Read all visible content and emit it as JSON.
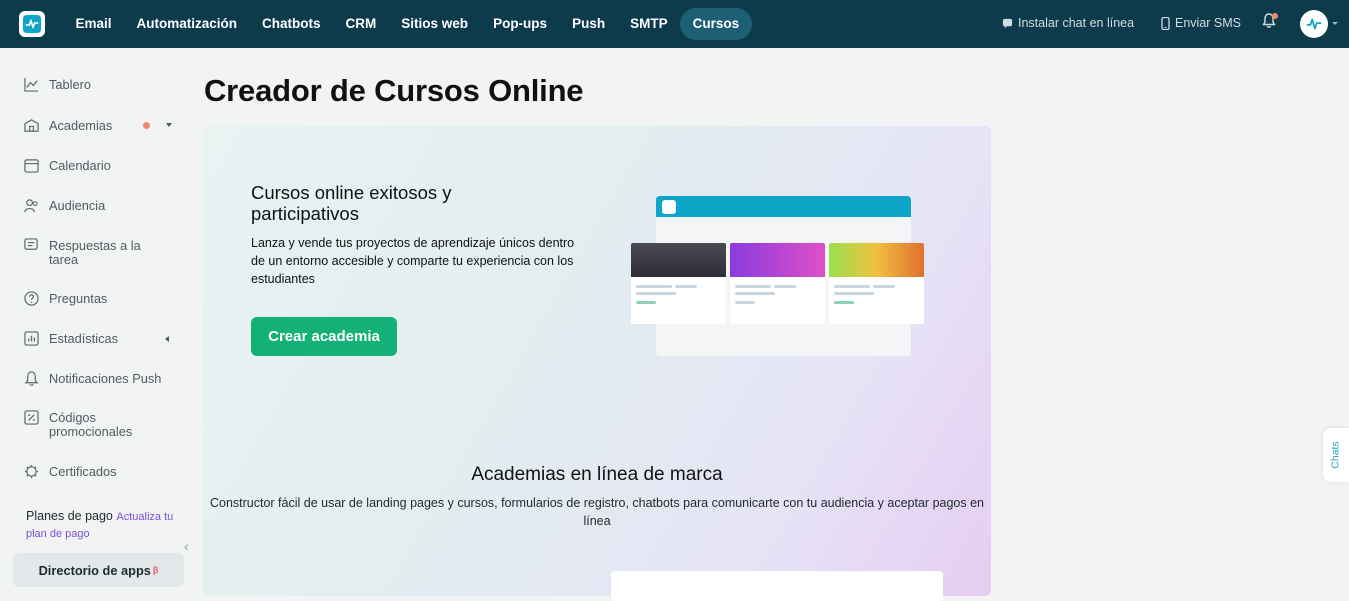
{
  "topnav": {
    "logo_icon": "pulse-logo",
    "items": [
      {
        "label": "Email"
      },
      {
        "label": "Automatización"
      },
      {
        "label": "Chatbots"
      },
      {
        "label": "CRM"
      },
      {
        "label": "Sitios web"
      },
      {
        "label": "Pop-ups"
      },
      {
        "label": "Push"
      },
      {
        "label": "SMTP"
      },
      {
        "label": "Cursos",
        "active": true
      }
    ],
    "install_chat": "Instalar chat en línea",
    "send_sms": "Enviar SMS",
    "notification_dot_color": "#f08a6a"
  },
  "sidebar": {
    "items": [
      {
        "label": "Tablero",
        "icon": "chart-line-icon"
      },
      {
        "label": "Academias",
        "icon": "academy-icon"
      },
      {
        "label": "Calendario",
        "icon": "calendar-icon"
      },
      {
        "label": "Audiencia",
        "icon": "users-icon"
      },
      {
        "label": "Respuestas a la tarea",
        "icon": "answers-icon"
      },
      {
        "label": "Preguntas",
        "icon": "question-icon"
      },
      {
        "label": "Estadísticas",
        "icon": "stats-icon"
      },
      {
        "label": "Notificaciones Push",
        "icon": "bell-icon"
      },
      {
        "label": "Códigos promocionales",
        "icon": "promo-icon"
      },
      {
        "label": "Certificados",
        "icon": "certificate-icon"
      }
    ],
    "plans_label": "Planes de pago",
    "plans_link": "Actualiza tu plan de pago",
    "app_directory": "Directorio de apps",
    "app_directory_badge": "β"
  },
  "main": {
    "title": "Creador de Cursos Online",
    "hero_heading": "Cursos online exitosos y participativos",
    "hero_text": "Lanza y vende tus proyectos de aprendizaje únicos dentro de un entorno accesible y comparte tu experiencia con los estudiantes",
    "cta_label": "Crear academia",
    "section_title": "Academias en línea de marca",
    "section_text": "Constructor fácil de usar de landing pages y cursos, formularios de registro, chatbots para comunicarte con tu audiencia y aceptar pagos en línea"
  },
  "chats_tab": "Chats",
  "colors": {
    "topbar": "#0d3b4c",
    "cta": "#13b078",
    "accent_link": "#7a4fd6"
  }
}
